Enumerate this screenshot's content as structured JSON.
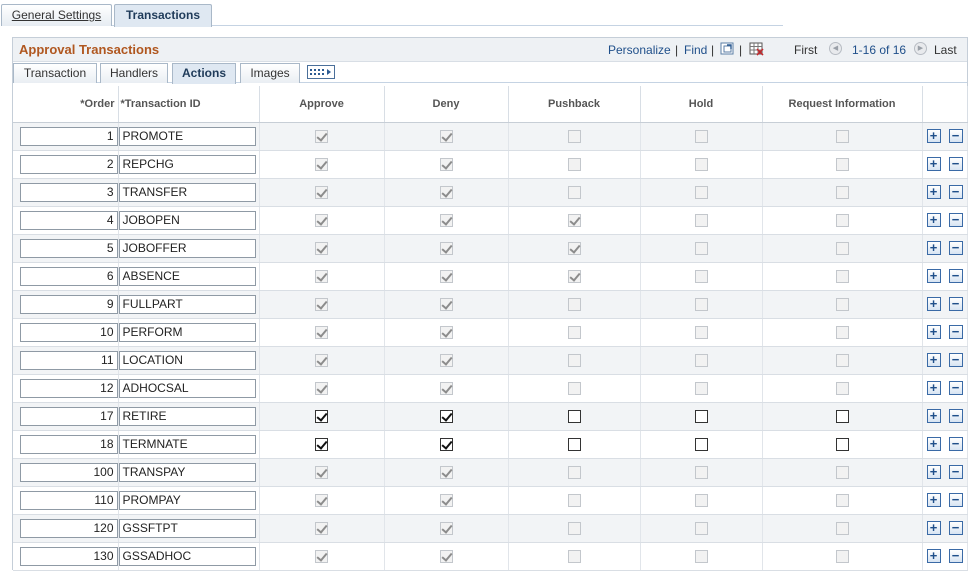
{
  "page_tabs": [
    {
      "label": "General Settings",
      "active": false
    },
    {
      "label": "Transactions",
      "active": true
    }
  ],
  "grid": {
    "title": "Approval Transactions",
    "personalize": "Personalize",
    "find": "Find",
    "first": "First",
    "range": "1-16 of 16",
    "last": "Last"
  },
  "sub_tabs": [
    {
      "label": "Transaction",
      "active": false
    },
    {
      "label": "Handlers",
      "active": false
    },
    {
      "label": "Actions",
      "active": true
    },
    {
      "label": "Images",
      "active": false
    }
  ],
  "columns": {
    "order": "*Order",
    "tid": "*Transaction ID",
    "approve": "Approve",
    "deny": "Deny",
    "pushback": "Pushback",
    "hold": "Hold",
    "request": "Request Information"
  },
  "rows": [
    {
      "order": "1",
      "tid": "PROMOTE",
      "enabled": false,
      "approve": true,
      "deny": true,
      "pushback": false,
      "hold": false,
      "request": false
    },
    {
      "order": "2",
      "tid": "REPCHG",
      "enabled": false,
      "approve": true,
      "deny": true,
      "pushback": false,
      "hold": false,
      "request": false
    },
    {
      "order": "3",
      "tid": "TRANSFER",
      "enabled": false,
      "approve": true,
      "deny": true,
      "pushback": false,
      "hold": false,
      "request": false
    },
    {
      "order": "4",
      "tid": "JOBOPEN",
      "enabled": false,
      "approve": true,
      "deny": true,
      "pushback": true,
      "hold": false,
      "request": false
    },
    {
      "order": "5",
      "tid": "JOBOFFER",
      "enabled": false,
      "approve": true,
      "deny": true,
      "pushback": true,
      "hold": false,
      "request": false
    },
    {
      "order": "6",
      "tid": "ABSENCE",
      "enabled": false,
      "approve": true,
      "deny": true,
      "pushback": true,
      "hold": false,
      "request": false
    },
    {
      "order": "9",
      "tid": "FULLPART",
      "enabled": false,
      "approve": true,
      "deny": true,
      "pushback": false,
      "hold": false,
      "request": false
    },
    {
      "order": "10",
      "tid": "PERFORM",
      "enabled": false,
      "approve": true,
      "deny": true,
      "pushback": false,
      "hold": false,
      "request": false
    },
    {
      "order": "11",
      "tid": "LOCATION",
      "enabled": false,
      "approve": true,
      "deny": true,
      "pushback": false,
      "hold": false,
      "request": false
    },
    {
      "order": "12",
      "tid": "ADHOCSAL",
      "enabled": false,
      "approve": true,
      "deny": true,
      "pushback": false,
      "hold": false,
      "request": false
    },
    {
      "order": "17",
      "tid": "RETIRE",
      "enabled": true,
      "approve": true,
      "deny": true,
      "pushback": false,
      "hold": false,
      "request": false
    },
    {
      "order": "18",
      "tid": "TERMNATE",
      "enabled": true,
      "approve": true,
      "deny": true,
      "pushback": false,
      "hold": false,
      "request": false
    },
    {
      "order": "100",
      "tid": "TRANSPAY",
      "enabled": false,
      "approve": true,
      "deny": true,
      "pushback": false,
      "hold": false,
      "request": false
    },
    {
      "order": "110",
      "tid": "PROMPAY",
      "enabled": false,
      "approve": true,
      "deny": true,
      "pushback": false,
      "hold": false,
      "request": false
    },
    {
      "order": "120",
      "tid": "GSSFTPT",
      "enabled": false,
      "approve": true,
      "deny": true,
      "pushback": false,
      "hold": false,
      "request": false
    },
    {
      "order": "130",
      "tid": "GSSADHOC",
      "enabled": false,
      "approve": true,
      "deny": true,
      "pushback": false,
      "hold": false,
      "request": false
    }
  ],
  "row_buttons": {
    "add": "+",
    "delete": "−"
  },
  "icons": [
    "zoom-icon",
    "download-icon",
    "first-arrow-icon",
    "last-arrow-icon",
    "show-all-columns-icon",
    "add-row-icon",
    "delete-row-icon"
  ]
}
